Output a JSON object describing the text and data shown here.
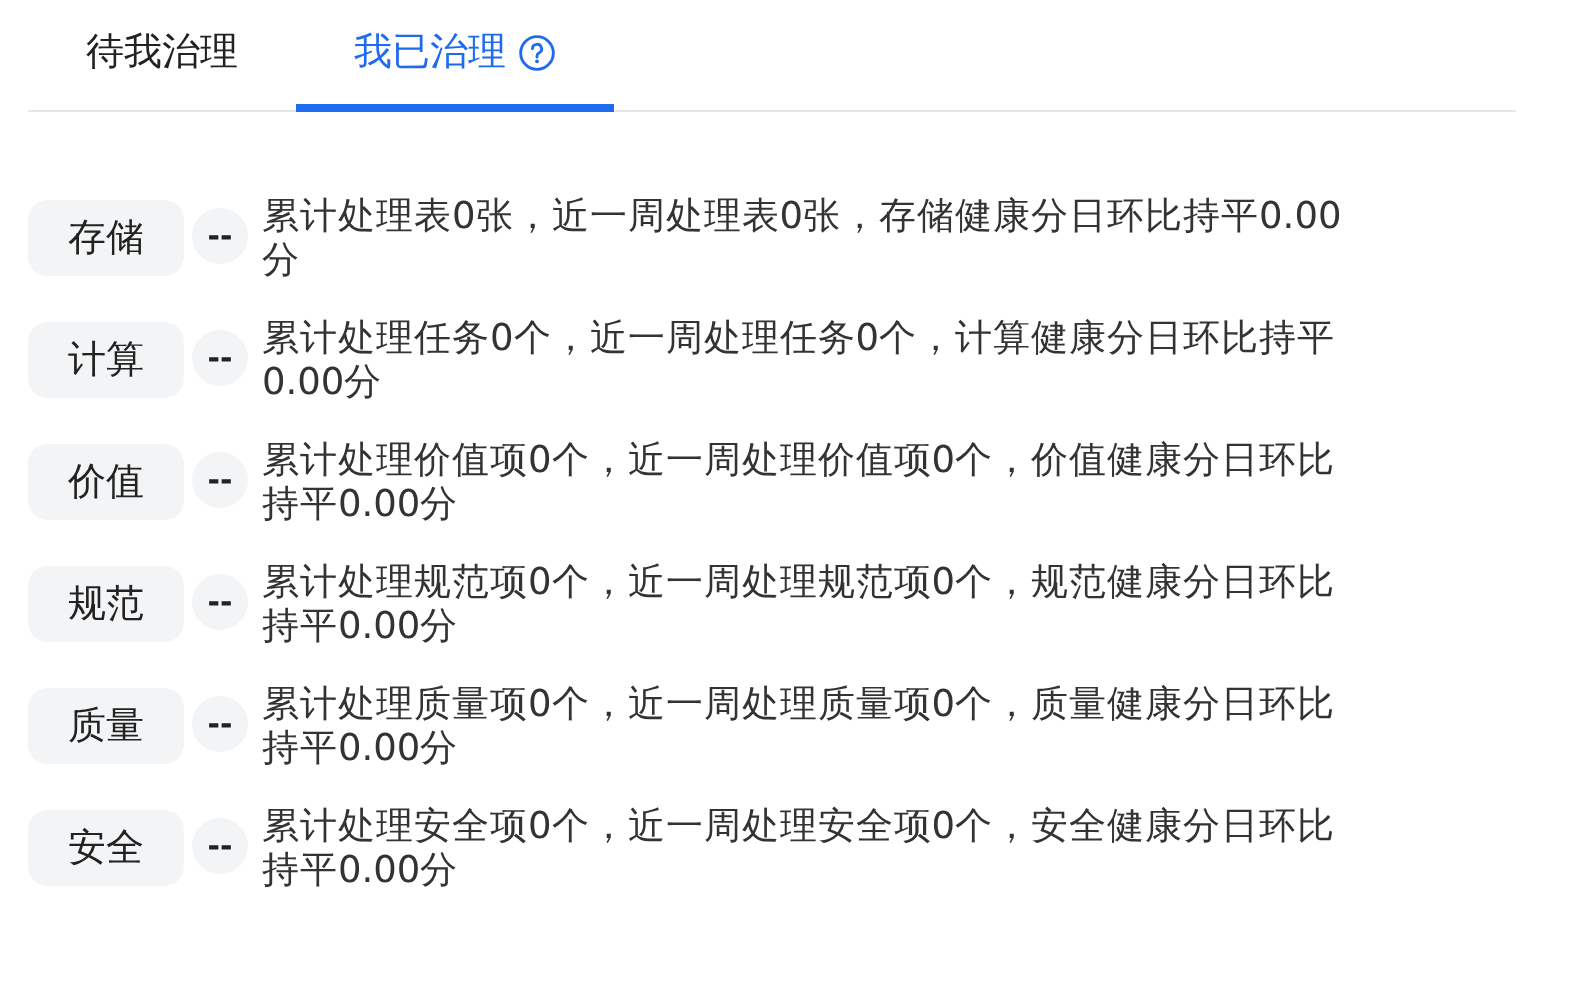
{
  "tabs": [
    {
      "label": "待我治理",
      "selected": false,
      "help_icon": false
    },
    {
      "label": "我已治理",
      "selected": true,
      "help_icon": true
    }
  ],
  "items": [
    {
      "category": "存储",
      "value": "--",
      "description": "累计处理表0张，近一周处理表0张，存储健康分日环比持平0.00分"
    },
    {
      "category": "计算",
      "value": "--",
      "description": "累计处理任务0个，近一周处理任务0个，计算健康分日环比持平0.00分"
    },
    {
      "category": "价值",
      "value": "--",
      "description": "累计处理价值项0个，近一周处理价值项0个，价值健康分日环比持平0.00分"
    },
    {
      "category": "规范",
      "value": "--",
      "description": "累计处理规范项0个，近一周处理规范项0个，规范健康分日环比持平0.00分"
    },
    {
      "category": "质量",
      "value": "--",
      "description": "累计处理质量项0个，近一周处理质量项0个，质量健康分日环比持平0.00分"
    },
    {
      "category": "安全",
      "value": "--",
      "description": "累计处理安全项0个，近一周处理安全项0个，安全健康分日环比持平0.00分"
    }
  ]
}
